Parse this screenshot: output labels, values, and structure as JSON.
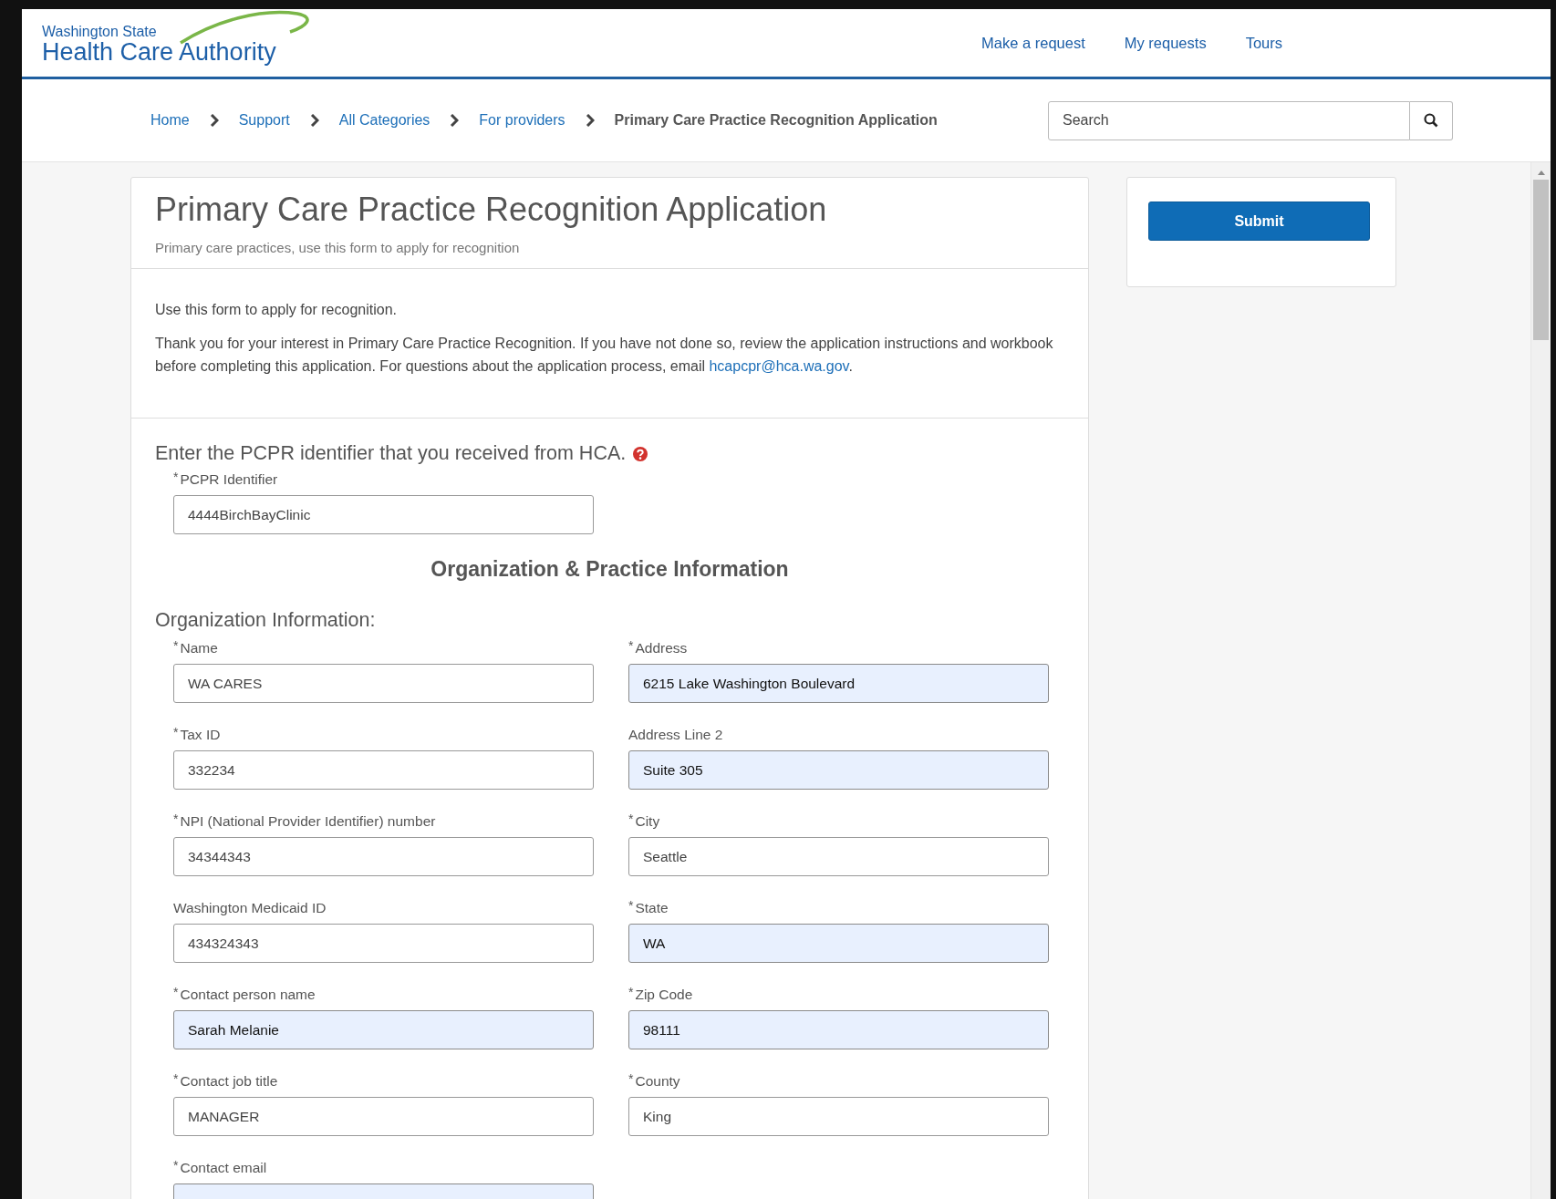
{
  "header": {
    "logo_top": "Washington State",
    "logo_name": "Health Care Authority",
    "nav": [
      "Make a request",
      "My requests",
      "Tours"
    ]
  },
  "breadcrumb": {
    "items": [
      {
        "label": "Home",
        "current": false
      },
      {
        "label": "Support",
        "current": false
      },
      {
        "label": "All Categories",
        "current": false
      },
      {
        "label": "For providers",
        "current": false
      },
      {
        "label": "Primary Care Practice Recognition Application",
        "current": true
      }
    ],
    "search": {
      "placeholder": "Search"
    }
  },
  "form": {
    "title": "Primary Care Practice Recognition Application",
    "subtitle": "Primary care practices, use this form to apply for recognition",
    "intro": "Use this form to apply for recognition.",
    "message": {
      "text": "Thank you for your interest in Primary Care Practice Recognition. If you have not done so, review the application instructions and workbook before completing this application. For questions about the application process, email ",
      "link": "hcapcpr@hca.wa.gov",
      "end": "."
    },
    "identifier_heading": "Enter the PCPR identifier that you received from HCA.",
    "identifier_field": {
      "marker": "*",
      "label": "PCPR Identifier",
      "value": "4444BirchBayClinic",
      "autofilled": false
    },
    "section_title": "Organization & Practice Information",
    "subsection_title": "Organization Information:",
    "fields": [
      {
        "marker": "*",
        "label": "Name",
        "value": "WA CARES",
        "autofilled": false
      },
      {
        "marker": "*",
        "label": "Address",
        "value": "6215 Lake Washington Boulevard",
        "autofilled": true
      },
      {
        "marker": "*",
        "label": "Tax ID",
        "value": "332234",
        "autofilled": false
      },
      {
        "label": "Address Line 2",
        "value": "Suite 305",
        "autofilled": true
      },
      {
        "marker": "*",
        "label": "NPI (National Provider Identifier) number",
        "value": "34344343",
        "autofilled": false
      },
      {
        "marker": "*",
        "label": "City",
        "value": "Seattle",
        "autofilled": false
      },
      {
        "label": "Washington Medicaid ID",
        "value": "434324343",
        "autofilled": false
      },
      {
        "marker": "*",
        "label": "State",
        "value": "WA",
        "autofilled": true
      },
      {
        "marker": "*",
        "label": "Contact person name",
        "value": "Sarah Melanie",
        "autofilled": true
      },
      {
        "marker": "*",
        "label": "Zip Code",
        "value": "98111",
        "autofilled": true
      },
      {
        "marker": "*",
        "label": "Contact job title",
        "value": "MANAGER",
        "autofilled": false
      },
      {
        "marker": "*",
        "label": "County",
        "value": "King",
        "autofilled": false
      },
      {
        "marker": "*",
        "label": "Contact email",
        "autofilled": true
      }
    ]
  },
  "actions": {
    "submit": "Submit"
  }
}
